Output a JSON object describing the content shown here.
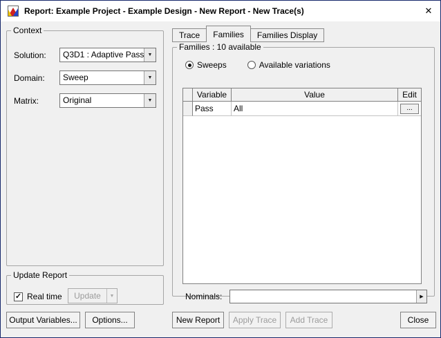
{
  "window": {
    "title": "Report: Example Project - Example Design - New Report - New Trace(s)"
  },
  "icons": {
    "close": "✕",
    "dropdown": "▼",
    "right_arrow": "▶",
    "check": "✓"
  },
  "context": {
    "legend": "Context",
    "fields": [
      {
        "label": "Solution:",
        "value": "Q3D1 : Adaptive Pass"
      },
      {
        "label": "Domain:",
        "value": "Sweep"
      },
      {
        "label": "Matrix:",
        "value": "Original"
      }
    ]
  },
  "update_report": {
    "legend": "Update Report",
    "realtime_label": "Real time",
    "realtime_checked": true,
    "update_label": "Update"
  },
  "footer_left": {
    "output_variables": "Output Variables...",
    "options": "Options..."
  },
  "tabs": [
    {
      "label": "Trace",
      "active": false
    },
    {
      "label": "Families",
      "active": true
    },
    {
      "label": "Families Display",
      "active": false
    }
  ],
  "families": {
    "legend": "Families : 10 available",
    "radios": [
      {
        "label": "Sweeps",
        "selected": true
      },
      {
        "label": "Available variations",
        "selected": false
      }
    ],
    "table": {
      "headers": {
        "selector": "",
        "variable": "Variable",
        "value": "Value",
        "edit": "Edit"
      },
      "row": {
        "variable": "Pass",
        "value": "All",
        "edit": "..."
      }
    },
    "nominals_label": "Nominals:"
  },
  "footer_right": {
    "new_report": "New Report",
    "apply_trace": "Apply Trace",
    "add_trace": "Add Trace",
    "close": "Close"
  }
}
